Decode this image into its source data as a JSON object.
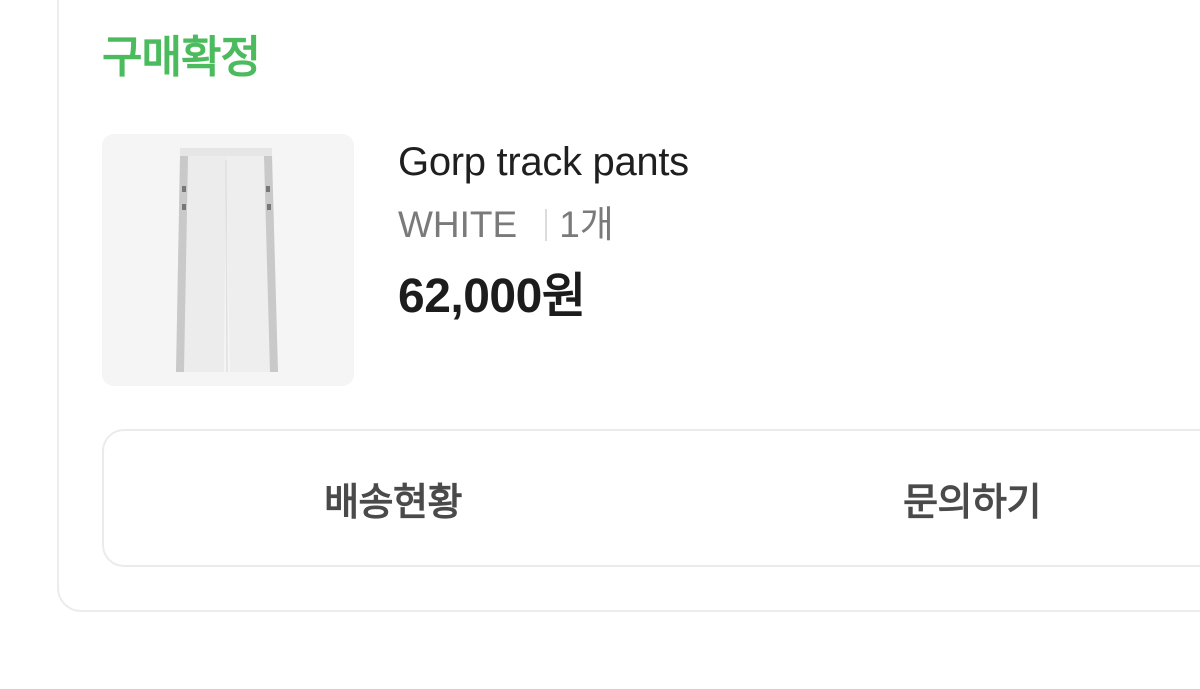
{
  "order": {
    "status_label": "구매확정",
    "status_color": "#4cbb5e",
    "product": {
      "image_icon": "track-pants-image",
      "name": "Gorp track pants",
      "option": "WHITE",
      "quantity": "1개",
      "price": "62,000원"
    },
    "actions": {
      "delivery_label": "배송현황",
      "inquiry_label": "문의하기"
    }
  }
}
